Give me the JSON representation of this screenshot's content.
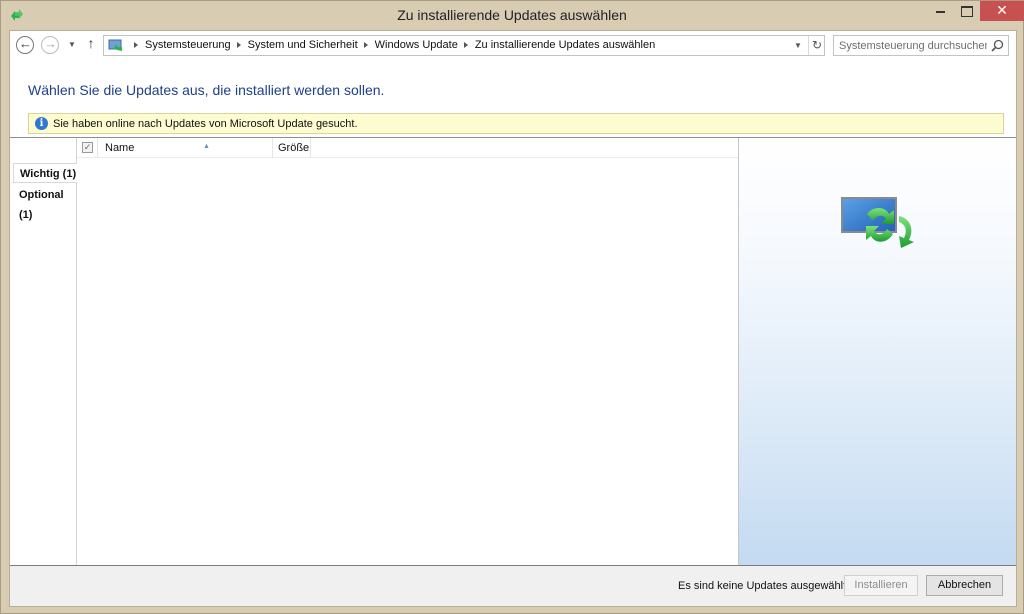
{
  "window": {
    "title": "Zu installierende Updates auswählen",
    "close_glyph": "✕"
  },
  "address": {
    "breadcrumbs": [
      "Systemsteuerung",
      "System und Sicherheit",
      "Windows Update",
      "Zu installierende Updates auswählen"
    ]
  },
  "search": {
    "placeholder": "Systemsteuerung durchsuchen"
  },
  "content": {
    "heading": "Wählen Sie die Updates aus, die installiert werden sollen.",
    "info_message": "Sie haben online nach Updates von Microsoft Update gesucht."
  },
  "categories": [
    {
      "label": "Wichtig (1)",
      "selected": true
    },
    {
      "label": "Optional (1)",
      "selected": false
    }
  ],
  "table": {
    "columns": [
      "Name",
      "Größe"
    ],
    "header_checked": true
  },
  "footer": {
    "status": "Es sind keine Updates ausgewählt.",
    "install_label": "Installieren",
    "install_enabled": false,
    "cancel_label": "Abbrechen"
  },
  "icons": {
    "window": "windows-update-icon",
    "back": "back-arrow-icon",
    "forward": "forward-arrow-icon",
    "up": "up-arrow-icon",
    "refresh": "refresh-icon",
    "search": "search-icon",
    "info": "info-icon",
    "detail": "windows-update-large-icon"
  },
  "colors": {
    "heading": "#1e3f8b",
    "info_bg": "#fdfbd0",
    "close_button": "#c75050",
    "update_green": "#2fb04a"
  }
}
